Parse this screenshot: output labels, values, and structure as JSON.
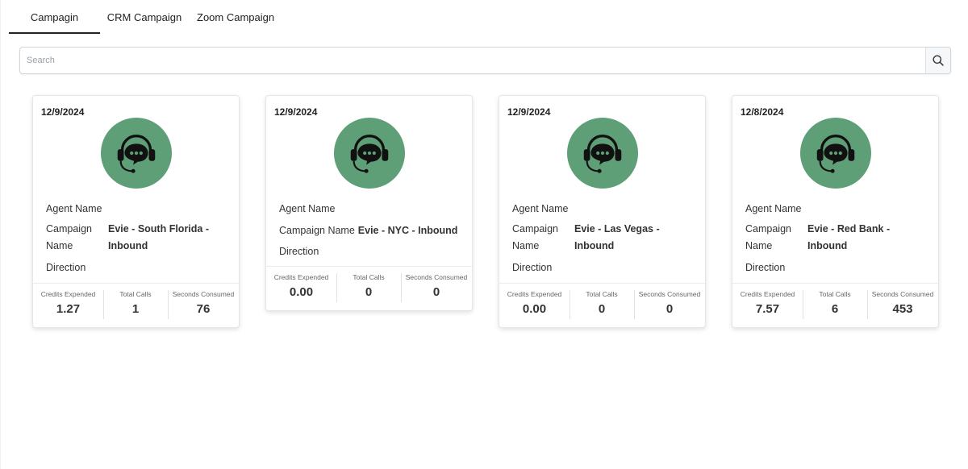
{
  "tabs": [
    {
      "label": "Campagin",
      "active": true
    },
    {
      "label": "CRM Campaign",
      "active": false
    },
    {
      "label": "Zoom Campaign",
      "active": false
    }
  ],
  "search": {
    "placeholder": "Search",
    "icon": "search-icon"
  },
  "card_labels": {
    "agent_name": "Agent Name",
    "campaign_name_line1": "Campaign",
    "campaign_name_line2": "Name",
    "campaign_name": "Campaign Name",
    "direction": "Direction",
    "credits_expended": "Credits Expended",
    "total_calls": "Total Calls",
    "seconds_consumed": "Seconds Consumed"
  },
  "avatar": {
    "icon": "headset-chat-icon",
    "color": "#5e9f77"
  },
  "cards": [
    {
      "date": "12/9/2024",
      "campaign_line1": "Evie - South Florida -",
      "campaign_line2": "Inbound",
      "credits": "1.27",
      "calls": "1",
      "seconds": "76"
    },
    {
      "date": "12/9/2024",
      "campaign_line1": "Evie - NYC - Inbound",
      "campaign_line2": "",
      "credits": "0.00",
      "calls": "0",
      "seconds": "0"
    },
    {
      "date": "12/9/2024",
      "campaign_line1": "Evie - Las Vegas -",
      "campaign_line2": "Inbound",
      "credits": "0.00",
      "calls": "0",
      "seconds": "0"
    },
    {
      "date": "12/8/2024",
      "campaign_line1": "Evie - Red Bank -",
      "campaign_line2": "Inbound",
      "credits": "7.57",
      "calls": "6",
      "seconds": "453"
    }
  ]
}
